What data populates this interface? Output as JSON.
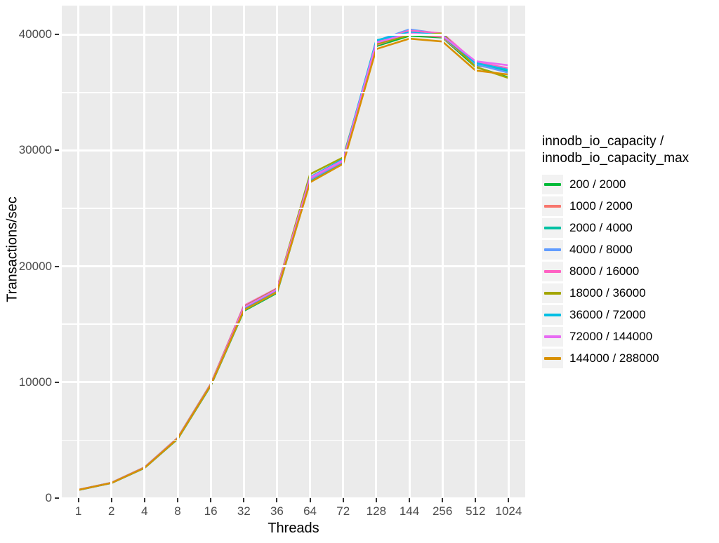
{
  "chart_data": {
    "type": "line",
    "title": "",
    "xlabel": "Threads",
    "ylabel": "Transactions/sec",
    "categories": [
      "1",
      "2",
      "4",
      "8",
      "16",
      "32",
      "36",
      "64",
      "72",
      "128",
      "144",
      "256",
      "512",
      "1024"
    ],
    "ylim": [
      0,
      42500
    ],
    "y_ticks": [
      0,
      10000,
      20000,
      30000,
      40000
    ],
    "y_tick_labels": [
      "0",
      "10000",
      "20000",
      "30000",
      "40000"
    ],
    "y_minor_ticks": [
      5000,
      15000,
      25000,
      35000
    ],
    "grid": true,
    "legend_position": "right",
    "legend_title": "innodb_io_capacity /\ninnodb_io_capacity_max",
    "series": [
      {
        "name": "200 / 2000",
        "color": "#00BA38",
        "values": [
          700,
          1300,
          2600,
          5100,
          9700,
          16150,
          17700,
          27350,
          28950,
          39000,
          39900,
          39750,
          37200,
          36300
        ]
      },
      {
        "name": "1000 / 2000",
        "color": "#F8766D",
        "values": [
          710,
          1310,
          2620,
          5150,
          9750,
          16250,
          17800,
          27450,
          29000,
          39100,
          40050,
          39800,
          37350,
          36900
        ]
      },
      {
        "name": "2000 / 4000",
        "color": "#00C1A3",
        "values": [
          705,
          1305,
          2610,
          5120,
          9720,
          16200,
          17750,
          27300,
          28900,
          39250,
          40150,
          39900,
          37400,
          36850
        ]
      },
      {
        "name": "4000 / 8000",
        "color": "#619CFF",
        "values": [
          715,
          1320,
          2640,
          5180,
          9800,
          16350,
          17900,
          27500,
          29050,
          39450,
          40450,
          40050,
          37450,
          36700
        ]
      },
      {
        "name": "8000 / 16000",
        "color": "#FF61C3",
        "values": [
          720,
          1330,
          2660,
          5200,
          9850,
          16600,
          18100,
          27600,
          29100,
          39400,
          40350,
          40100,
          37600,
          37100
        ]
      },
      {
        "name": "18000 / 36000",
        "color": "#A3A500",
        "values": [
          718,
          1325,
          2650,
          5190,
          9830,
          16500,
          18050,
          27950,
          29400,
          39200,
          39950,
          40100,
          37200,
          36250
        ]
      },
      {
        "name": "36000 / 72000",
        "color": "#00BFE4",
        "values": [
          712,
          1315,
          2630,
          5160,
          9780,
          16300,
          17850,
          27700,
          29250,
          39500,
          40200,
          39950,
          37550,
          36950
        ]
      },
      {
        "name": "72000 / 144000",
        "color": "#E76BF3",
        "values": [
          716,
          1318,
          2635,
          5170,
          9790,
          16450,
          18000,
          27650,
          29150,
          39300,
          40100,
          39900,
          37700,
          37350
        ]
      },
      {
        "name": "144000 / 288000",
        "color": "#D89000",
        "values": [
          708,
          1308,
          2615,
          5130,
          9740,
          16220,
          17780,
          27250,
          28850,
          38750,
          39650,
          39400,
          36900,
          36550
        ]
      }
    ]
  },
  "axes": {
    "x_title": "Threads",
    "y_title": "Transactions/sec"
  },
  "legend": {
    "title_line1": "innodb_io_capacity /",
    "title_line2": "innodb_io_capacity_max",
    "entries": [
      {
        "label": "200 / 2000",
        "color": "#00BA38"
      },
      {
        "label": "1000 / 2000",
        "color": "#F8766D"
      },
      {
        "label": "2000 / 4000",
        "color": "#00C1A3"
      },
      {
        "label": "4000 / 8000",
        "color": "#619CFF"
      },
      {
        "label": "8000 / 16000",
        "color": "#FF61C3"
      },
      {
        "label": "18000 / 36000",
        "color": "#A3A500"
      },
      {
        "label": "36000 / 72000",
        "color": "#00BFE4"
      },
      {
        "label": "72000 / 144000",
        "color": "#E76BF3"
      },
      {
        "label": "144000 / 288000",
        "color": "#D89000"
      }
    ]
  },
  "theme": {
    "panel_bg": "#EBEBEB",
    "grid_color": "#FFFFFF",
    "figure_bg": "#FFFFFF",
    "tick_text_color": "#4D4D4D",
    "axis_title_color": "#000000"
  }
}
